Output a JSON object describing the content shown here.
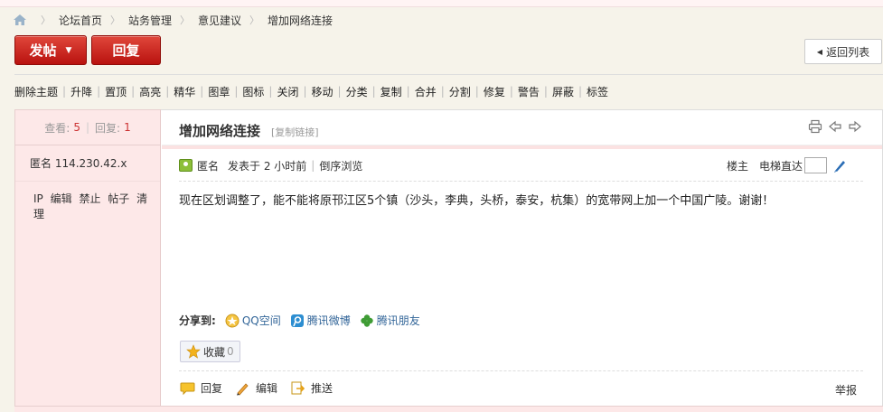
{
  "breadcrumb": {
    "items": [
      "论坛首页",
      "站务管理",
      "意见建议",
      "增加网络连接"
    ]
  },
  "actions": {
    "post_label": "发帖",
    "reply_label": "回复",
    "back_label": "返回列表"
  },
  "mod_toolbar": [
    "删除主题",
    "升降",
    "置顶",
    "高亮",
    "精华",
    "图章",
    "图标",
    "关闭",
    "移动",
    "分类",
    "复制",
    "合并",
    "分割",
    "修复",
    "警告",
    "屏蔽",
    "标签"
  ],
  "thread": {
    "views_label": "查看:",
    "views": "5",
    "replies_label": "回复:",
    "replies": "1",
    "title": "增加网络连接",
    "copy_link": "[复制链接]"
  },
  "author": {
    "name": "匿名 114.230.42.x",
    "actions": [
      "IP",
      "编辑",
      "禁止",
      "帖子",
      "清理"
    ]
  },
  "post": {
    "author_label": "匿名",
    "posted_time": "发表于 2 小时前",
    "reverse_label": "倒序浏览",
    "floor_label": "楼主",
    "jump_label": "电梯直达",
    "content": "现在区划调整了，能不能将原邗江区5个镇（沙头，李典，头桥，泰安，杭集）的宽带网上加一个中国广陵。谢谢！"
  },
  "share": {
    "label": "分享到:",
    "targets": [
      "QQ空间",
      "腾讯微博",
      "腾讯朋友"
    ]
  },
  "favorite": {
    "label": "收藏",
    "count": "0"
  },
  "footer": {
    "reply_label": "回复",
    "edit_label": "编辑",
    "recommend_label": "推送",
    "report_label": "举报"
  },
  "colors": {
    "accent_red": "#c1120f",
    "side_bg": "#fde8e8",
    "link_blue": "#336699"
  }
}
